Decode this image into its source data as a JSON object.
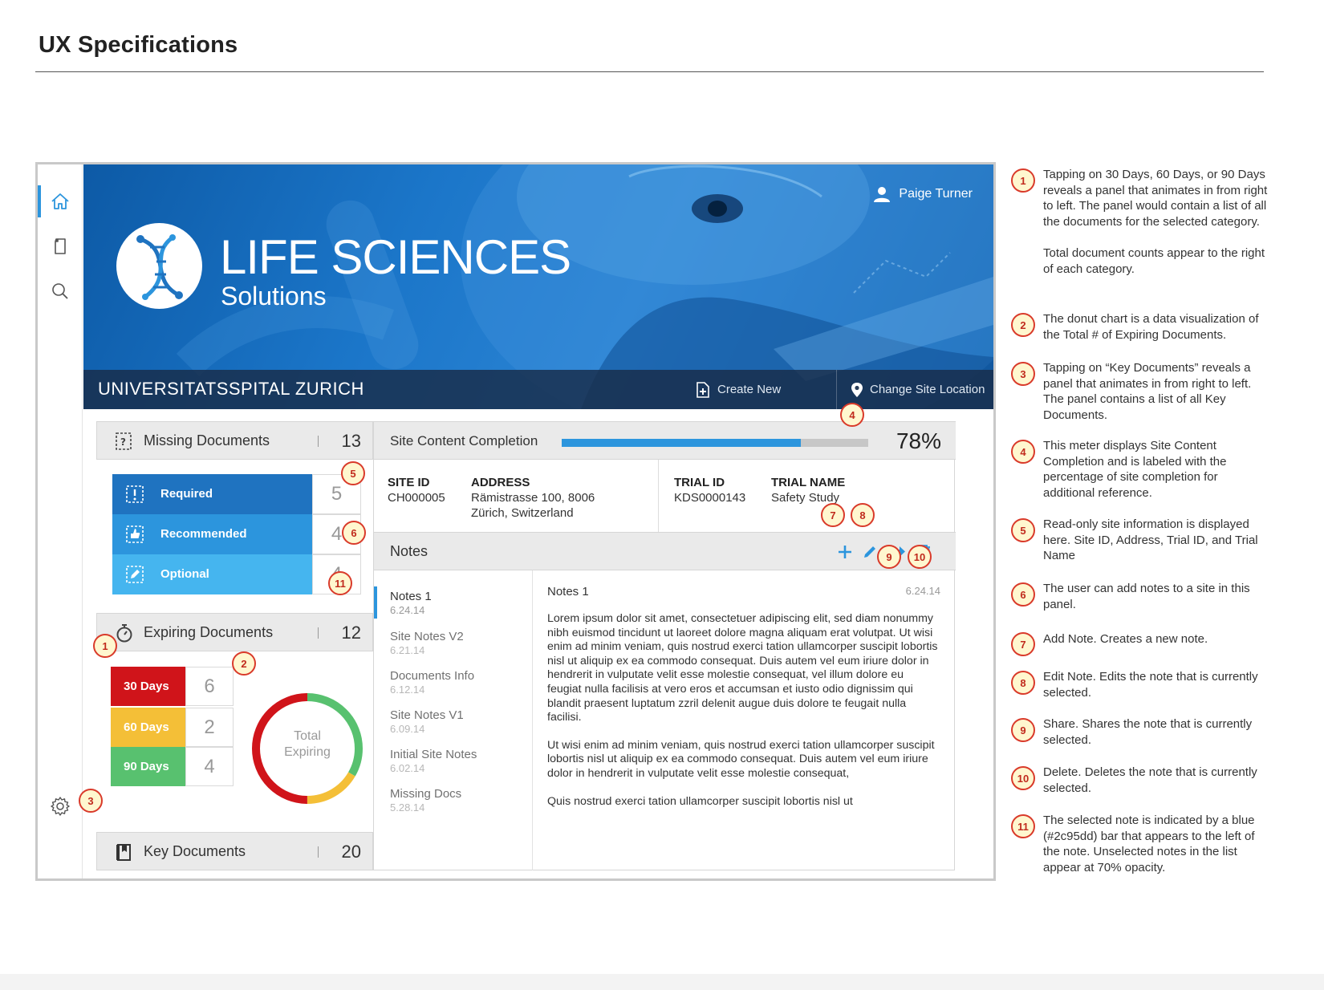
{
  "page": {
    "title": "UX Specifications"
  },
  "sidebar": {
    "items": [
      {
        "icon": "home-icon"
      },
      {
        "icon": "document-icon"
      },
      {
        "icon": "search-icon"
      },
      {
        "icon": "gear-icon"
      }
    ]
  },
  "header": {
    "user_name": "Paige Turner",
    "logo_main": "LIFE SCIENCES",
    "logo_sub": "Solutions",
    "site_name": "UNIVERSITATSSPITAL ZURICH",
    "create_new": "Create New",
    "change_site": "Change Site Location"
  },
  "missing": {
    "label": "Missing Documents",
    "count": "13",
    "rows": [
      {
        "label": "Required",
        "count": "5",
        "color": "#1f73c0"
      },
      {
        "label": "Recommended",
        "count": "4",
        "color": "#2c95dd"
      },
      {
        "label": "Optional",
        "count": "4",
        "color": "#45b5ef"
      }
    ]
  },
  "expiring": {
    "label": "Expiring Documents",
    "count": "12",
    "rows": [
      {
        "label": "30 Days",
        "count": "6",
        "color": "#d0141a"
      },
      {
        "label": "60 Days",
        "count": "2",
        "color": "#f4bf37"
      },
      {
        "label": "90 Days",
        "count": "4",
        "color": "#58c16f"
      }
    ],
    "donut_label_1": "Total",
    "donut_label_2": "Expiring"
  },
  "key_docs": {
    "label": "Key Documents",
    "count": "20"
  },
  "completion": {
    "label": "Site Content Completion",
    "percent": 78,
    "percent_label": "78%"
  },
  "site_info": {
    "site_id_label": "SITE ID",
    "site_id": "CH000005",
    "address_label": "ADDRESS",
    "address_1": "Rämistrasse 100, 8006",
    "address_2": "Zürich, Switzerland",
    "trial_id_label": "TRIAL ID",
    "trial_id": "KDS0000143",
    "trial_name_label": "TRIAL NAME",
    "trial_name": "Safety Study"
  },
  "notes": {
    "title": "Notes",
    "list": [
      {
        "title": "Notes 1",
        "date": "6.24.14"
      },
      {
        "title": "Site Notes V2",
        "date": "6.21.14"
      },
      {
        "title": "Documents Info",
        "date": "6.12.14"
      },
      {
        "title": "Site Notes V1",
        "date": "6.09.14"
      },
      {
        "title": "Initial Site Notes",
        "date": "6.02.14"
      },
      {
        "title": "Missing Docs",
        "date": "5.28.14"
      }
    ],
    "selected_title": "Notes 1",
    "selected_date": "6.24.14",
    "body_1": "Lorem ipsum dolor sit amet, consectetuer adipiscing elit, sed diam nonummy nibh euismod tincidunt ut laoreet dolore magna aliquam erat volutpat. Ut wisi enim ad minim veniam, quis nostrud exerci tation ullamcorper suscipit lobortis nisl ut aliquip ex ea commodo consequat. Duis autem vel eum iriure dolor in hendrerit in vulputate velit esse molestie consequat, vel illum dolore eu feugiat nulla facilisis at vero eros et accumsan et iusto odio dignissim qui blandit praesent luptatum zzril delenit augue duis dolore te feugait nulla facilisi.",
    "body_2": "Ut wisi enim ad minim veniam, quis nostrud exerci tation ullamcorper suscipit lobortis nisl ut aliquip ex ea commodo consequat. Duis autem vel eum iriure dolor in hendrerit in vulputate velit esse molestie consequat,",
    "body_3": "Quis nostrud exerci tation ullamcorper suscipit lobortis nisl ut"
  },
  "callouts": [
    "1",
    "2",
    "3",
    "4",
    "5",
    "6",
    "7",
    "8",
    "9",
    "10",
    "11"
  ],
  "specs": [
    {
      "num": "1",
      "text": "Tapping on 30 Days, 60 Days, or 90 Days reveals a panel that animates in from right to left. The panel would contain a list of all the documents for the selected category.",
      "text2": "Total document counts appear to the right of each category."
    },
    {
      "num": "2",
      "text": "The donut chart is a data visualization of the Total # of Expiring Documents."
    },
    {
      "num": "3",
      "text": "Tapping on “Key Documents” reveals a panel that animates in from right to left. The panel contains a list of all Key Documents."
    },
    {
      "num": "4",
      "text": "This meter displays Site Content Completion and is labeled with the percentage of site completion for additional reference."
    },
    {
      "num": "5",
      "text": "Read-only site information is displayed here. Site ID, Address, Trial ID, and Trial Name"
    },
    {
      "num": "6",
      "text": "The user can add notes to a site in this panel."
    },
    {
      "num": "7",
      "text": "Add Note. Creates a new note."
    },
    {
      "num": "8",
      "text": "Edit Note. Edits the note that is currently selected."
    },
    {
      "num": "9",
      "text": "Share. Shares the note that is currently selected."
    },
    {
      "num": "10",
      "text": "Delete. Deletes the note that is currently selected."
    },
    {
      "num": "11",
      "text": "The selected note is indicated by a blue (#2c95dd) bar that appears to the left of the note. Unselected notes in the list appear at 70% opacity."
    }
  ],
  "colors": {
    "accent": "#2c95dd",
    "badge_border": "#d93a2a",
    "badge_fill": "#fff7cf"
  }
}
